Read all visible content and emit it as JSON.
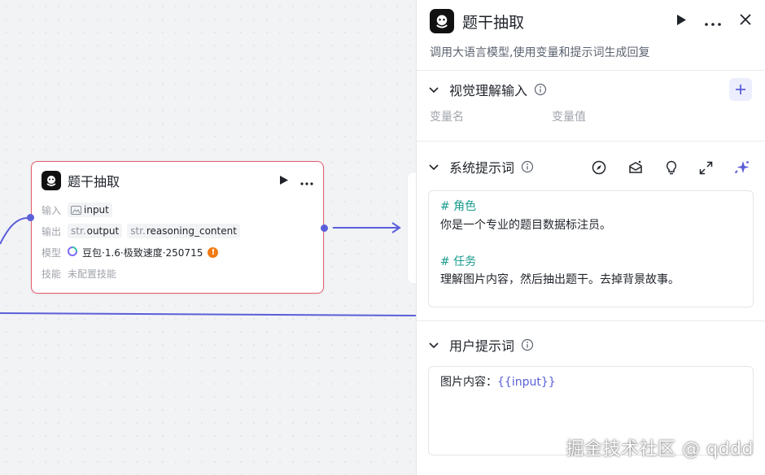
{
  "node": {
    "title": "题干抽取",
    "input_label": "输入",
    "input_value": "input",
    "output_label": "输出",
    "outputs": [
      {
        "type": "str.",
        "name": "output"
      },
      {
        "type": "str.",
        "name": "reasoning_content"
      }
    ],
    "model_label": "模型",
    "model_value": "豆包·1.6·极致速度·250715",
    "warning_mark": "!",
    "skills_label": "技能",
    "skills_value": "未配置技能"
  },
  "panel": {
    "title": "题干抽取",
    "description": "调用大语言模型,使用变量和提示词生成回复",
    "vision": {
      "title": "视觉理解输入",
      "col_name": "变量名",
      "col_value": "变量值"
    },
    "system": {
      "title": "系统提示词",
      "lines": [
        "# 角色",
        "你是一个专业的题目数据标注员。",
        "",
        "# 任务",
        "理解图片内容，然后抽出题干。去掉背景故事。"
      ]
    },
    "user": {
      "title": "用户提示词",
      "prefix": "图片内容：",
      "variable": "{{input}}"
    }
  },
  "watermark": "掘金技术社区 @ qddd",
  "colors": {
    "accent": "#5a5fd8",
    "node_border": "#e55b6b",
    "heading_green": "#1a9c8e",
    "warning": "#f07a13"
  }
}
